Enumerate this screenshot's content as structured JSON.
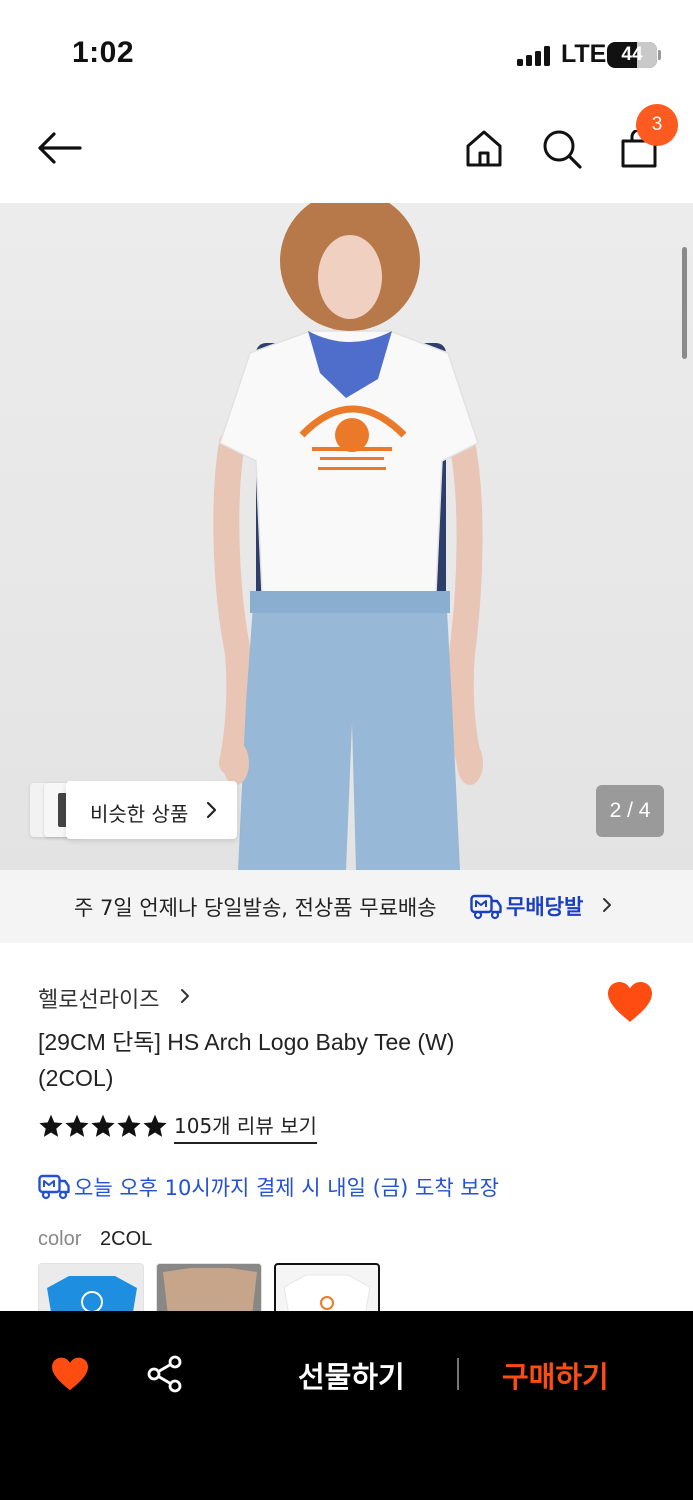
{
  "status_bar": {
    "time": "1:02",
    "network": "LTE",
    "battery": "44"
  },
  "nav": {
    "cart_count": "3"
  },
  "hero": {
    "similar_label": "비슷한 상품",
    "page_counter": "2 / 4",
    "image_current": 2,
    "image_total": 4
  },
  "delivery": {
    "text": "주 7일 언제나 당일발송, 전상품 무료배송",
    "brand": "무배당발"
  },
  "product": {
    "brand": "헬로선라이즈",
    "title_line1": "[29CM 단독] HS Arch Logo Baby Tee (W)",
    "title_line2": "(2COL)",
    "rating_stars": 5,
    "review_link": "105개 리뷰 보기",
    "guarantee": "오늘 오후 10시까지 결제 시 내일 (금) 도착 보장",
    "color_label": "color",
    "color_value": "2COL"
  },
  "swatches": [
    {
      "name": "blue-tee",
      "color": "#1e8fe0"
    },
    {
      "name": "brown-tee",
      "color": "#b5a08a"
    },
    {
      "name": "white-tee",
      "color": "#ffffff",
      "selected": true
    }
  ],
  "bottom_bar": {
    "gift_label": "선물하기",
    "buy_label": "구매하기"
  },
  "colors": {
    "accent": "#ff5a1f",
    "link_blue": "#2351d6",
    "brand_blue": "#1a3fbf"
  }
}
